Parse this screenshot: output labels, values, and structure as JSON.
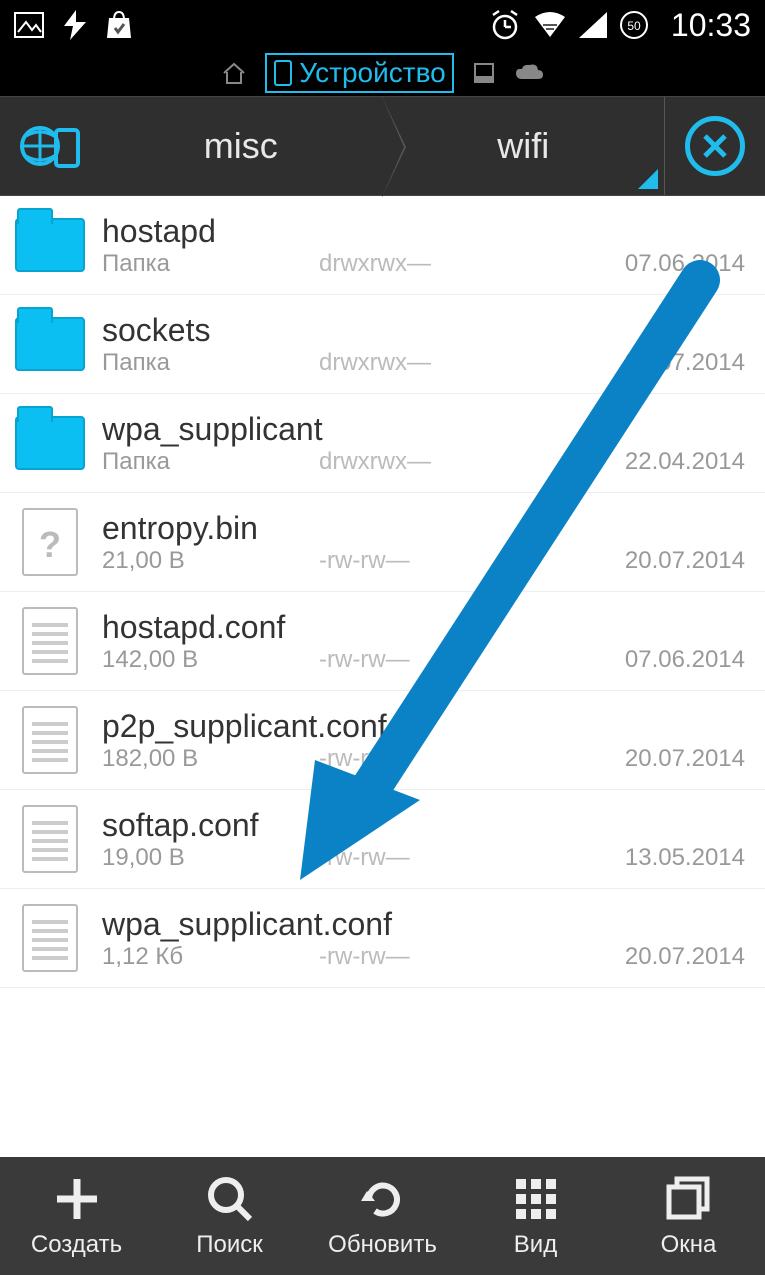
{
  "status": {
    "time": "10:33"
  },
  "header": {
    "tab_label": "Устройство"
  },
  "breadcrumbs": {
    "crumb1": "misc",
    "crumb2": "wifi"
  },
  "files": [
    {
      "name": "hostapd",
      "type": "folder",
      "sub": "Папка",
      "perm": "drwxrwx—",
      "date": "07.06.2014"
    },
    {
      "name": "sockets",
      "type": "folder",
      "sub": "Папка",
      "perm": "drwxrwx—",
      "date": "20.07.2014"
    },
    {
      "name": "wpa_supplicant",
      "type": "folder",
      "sub": "Папка",
      "perm": "drwxrwx—",
      "date": "22.04.2014"
    },
    {
      "name": "entropy.bin",
      "type": "unknown",
      "sub": "21,00 B",
      "perm": "-rw-rw—",
      "date": "20.07.2014"
    },
    {
      "name": "hostapd.conf",
      "type": "text",
      "sub": "142,00 B",
      "perm": "-rw-rw—",
      "date": "07.06.2014"
    },
    {
      "name": "p2p_supplicant.conf",
      "type": "text",
      "sub": "182,00 B",
      "perm": "-rw-rw—",
      "date": "20.07.2014"
    },
    {
      "name": "softap.conf",
      "type": "text",
      "sub": "19,00 B",
      "perm": "-rw-rw—",
      "date": "13.05.2014"
    },
    {
      "name": "wpa_supplicant.conf",
      "type": "text",
      "sub": "1,12 Кб",
      "perm": "-rw-rw—",
      "date": "20.07.2014"
    }
  ],
  "bottom": {
    "create": "Создать",
    "search": "Поиск",
    "refresh": "Обновить",
    "view": "Вид",
    "windows": "Окна"
  },
  "colors": {
    "accent": "#1fbced"
  }
}
